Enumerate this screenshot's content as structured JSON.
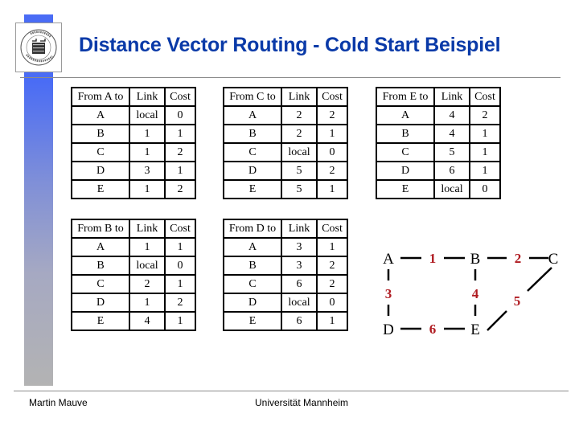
{
  "slide": {
    "title": "Distance Vector Routing - Cold Start Beispiel",
    "accent_color": "#0a3aa8",
    "edge_label_color": "#b01c22",
    "footer": {
      "author": "Martin Mauve",
      "institution": "Universität Mannheim"
    }
  },
  "tables": {
    "a": {
      "headers": [
        "From A to",
        "Link",
        "Cost"
      ],
      "rows": [
        [
          "A",
          "local",
          "0"
        ],
        [
          "B",
          "1",
          "1"
        ],
        [
          "C",
          "1",
          "2"
        ],
        [
          "D",
          "3",
          "1"
        ],
        [
          "E",
          "1",
          "2"
        ]
      ]
    },
    "c": {
      "headers": [
        "From C to",
        "Link",
        "Cost"
      ],
      "rows": [
        [
          "A",
          "2",
          "2"
        ],
        [
          "B",
          "2",
          "1"
        ],
        [
          "C",
          "local",
          "0"
        ],
        [
          "D",
          "5",
          "2"
        ],
        [
          "E",
          "5",
          "1"
        ]
      ]
    },
    "e": {
      "headers": [
        "From E to",
        "Link",
        "Cost"
      ],
      "rows": [
        [
          "A",
          "4",
          "2"
        ],
        [
          "B",
          "4",
          "1"
        ],
        [
          "C",
          "5",
          "1"
        ],
        [
          "D",
          "6",
          "1"
        ],
        [
          "E",
          "local",
          "0"
        ]
      ]
    },
    "b": {
      "headers": [
        "From B to",
        "Link",
        "Cost"
      ],
      "rows": [
        [
          "A",
          "1",
          "1"
        ],
        [
          "B",
          "local",
          "0"
        ],
        [
          "C",
          "2",
          "1"
        ],
        [
          "D",
          "1",
          "2"
        ],
        [
          "E",
          "4",
          "1"
        ]
      ]
    },
    "d": {
      "headers": [
        "From D to",
        "Link",
        "Cost"
      ],
      "rows": [
        [
          "A",
          "3",
          "1"
        ],
        [
          "B",
          "3",
          "2"
        ],
        [
          "C",
          "6",
          "2"
        ],
        [
          "D",
          "local",
          "0"
        ],
        [
          "E",
          "6",
          "1"
        ]
      ]
    }
  },
  "graph": {
    "nodes": [
      "A",
      "B",
      "C",
      "D",
      "E"
    ],
    "edges": [
      {
        "from": "A",
        "to": "B",
        "label": "1"
      },
      {
        "from": "B",
        "to": "C",
        "label": "2"
      },
      {
        "from": "A",
        "to": "D",
        "label": "3"
      },
      {
        "from": "B",
        "to": "E",
        "label": "4"
      },
      {
        "from": "C",
        "to": "E",
        "label": "5"
      },
      {
        "from": "D",
        "to": "E",
        "label": "6"
      }
    ]
  }
}
